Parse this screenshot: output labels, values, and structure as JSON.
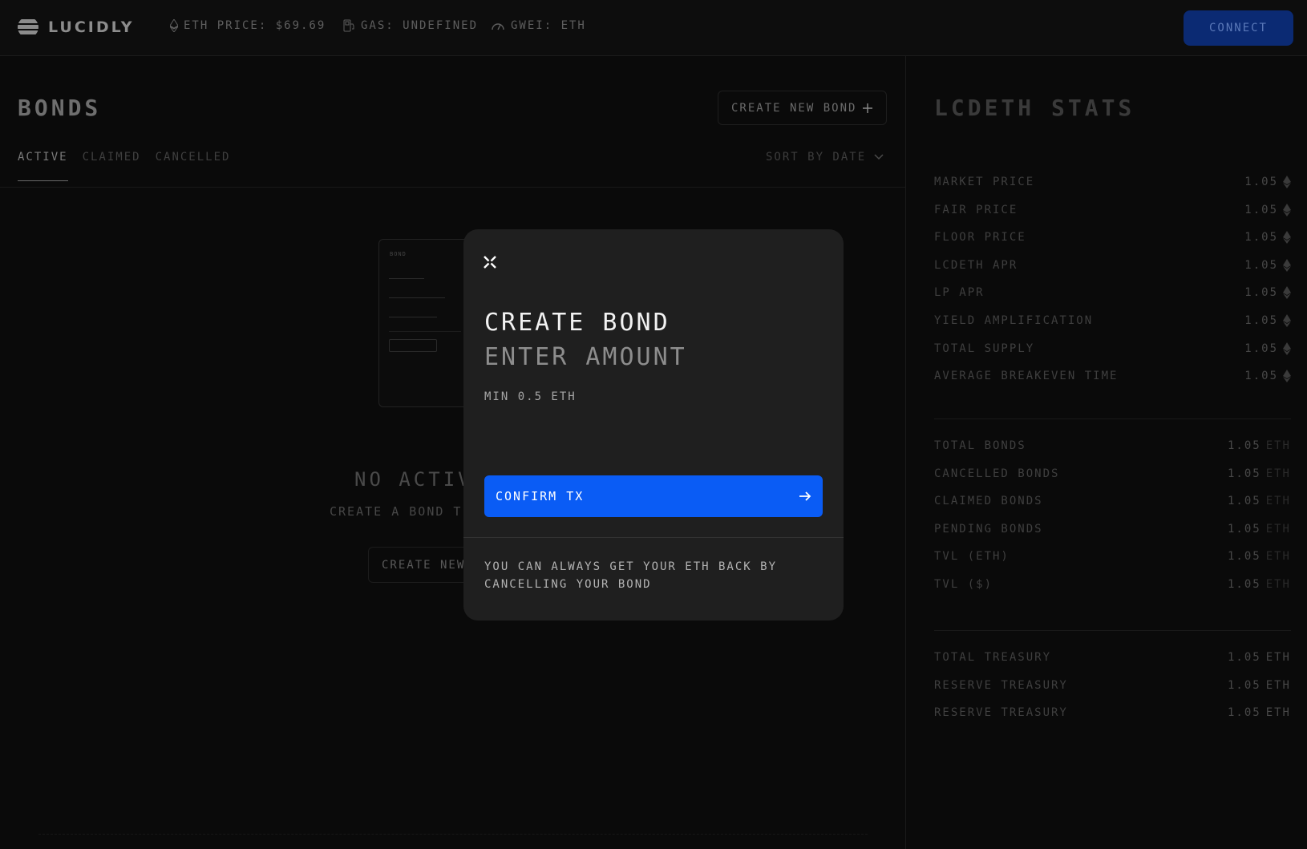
{
  "app": {
    "brand": "LUCIDLY",
    "eth_price": "ETH PRICE: $69.69",
    "gas": "GAS: UNDEFINED",
    "gwei": "GWEI: ETH",
    "connect_label": "CONNECT"
  },
  "bonds": {
    "title": "BONDS",
    "create_new_label": "CREATE NEW BOND",
    "tabs": [
      "ACTIVE",
      "CLAIMED",
      "CANCELLED"
    ],
    "active_tab": "ACTIVE",
    "sort_label": "SORT BY DATE",
    "illustration_label": "BOND",
    "empty_title": "NO ACTIVE",
    "empty_subtitle": "CREATE A BOND T",
    "empty_button": "CREATE NEW"
  },
  "stats": {
    "title": "LCDETH STATS",
    "group1": [
      {
        "label": "MARKET PRICE",
        "value": "1.05"
      },
      {
        "label": "FAIR PRICE",
        "value": "1.05"
      },
      {
        "label": "FLOOR PRICE",
        "value": "1.05"
      },
      {
        "label": "LCDETH APR",
        "value": "1.05"
      },
      {
        "label": "LP APR",
        "value": "1.05"
      },
      {
        "label": "YIELD AMPLIFICATION",
        "value": "1.05"
      },
      {
        "label": "TOTAL SUPPLY",
        "value": "1.05"
      },
      {
        "label": "AVERAGE BREAKEVEN TIME",
        "value": "1.05"
      }
    ],
    "group2": [
      {
        "label": "TOTAL BONDS",
        "value": "1.05",
        "unit": "ETH"
      },
      {
        "label": "CANCELLED BONDS",
        "value": "1.05",
        "unit": "ETH"
      },
      {
        "label": "CLAIMED BONDS",
        "value": "1.05",
        "unit": "ETH"
      },
      {
        "label": "PENDING BONDS",
        "value": "1.05",
        "unit": "ETH"
      },
      {
        "label": "TVL (ETH)",
        "value": "1.05",
        "unit": "ETH"
      },
      {
        "label": "TVL ($)",
        "value": "1.05",
        "unit": "ETH"
      }
    ],
    "group3": [
      {
        "label": "TOTAL TREASURY",
        "value": "1.05",
        "unit": "ETH"
      },
      {
        "label": "RESERVE TREASURY",
        "value": "1.05",
        "unit": "ETH"
      },
      {
        "label": "RESERVE TREASURY",
        "value": "1.05",
        "unit": "ETH"
      }
    ]
  },
  "modal": {
    "title": "CREATE BOND",
    "subtitle": "ENTER AMOUNT",
    "min_label": "MIN 0.5 ETH",
    "confirm_label": "CONFIRM TX",
    "note": "YOU CAN ALWAYS GET YOUR ETH BACK BY CANCELLING YOUR BOND"
  },
  "colors": {
    "accent": "#0a5cf5",
    "connect_bg": "#0b2a73",
    "modal_bg": "#1f1f1f",
    "page_bg": "#0b0b0b"
  }
}
